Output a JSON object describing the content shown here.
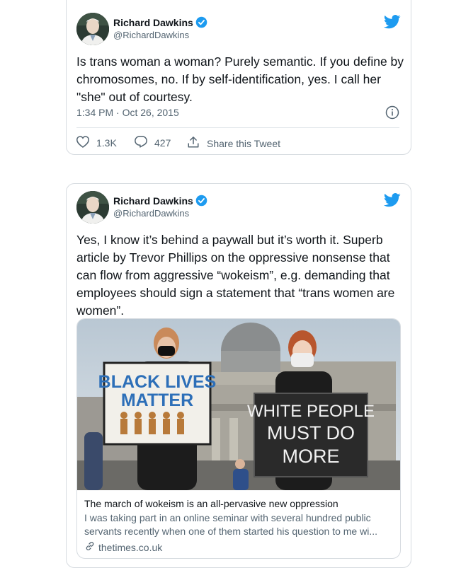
{
  "tweets": [
    {
      "author": "Richard Dawkins",
      "handle": "@RichardDawkins",
      "text": "Is trans woman a woman? Purely semantic. If you define by chromosomes, no. If by self-identification, yes. I call her \"she\" out of courtesy.",
      "timestamp": "1:34 PM · Oct 26, 2015",
      "likes": "1.3K",
      "replies": "427",
      "share_label": "Share this Tweet"
    },
    {
      "author": "Richard Dawkins",
      "handle": "@RichardDawkins",
      "text": "Yes, I know it’s behind a paywall but it’s worth it. Superb article by Trevor Phillips on the oppressive nonsense that can flow from aggressive “wokeism”, e.g. demanding that employees should sign a statement that “trans women are women”.",
      "link_card": {
        "title": "The march of wokeism is an all-pervasive new oppression",
        "description": "I was taking part in an online seminar with several hundred public servants recently when one of them started his question to me wi...",
        "domain": "thetimes.co.uk",
        "image": {
          "sign_left_line1": "BLACK LIVES",
          "sign_left_line2": "MATTER",
          "sign_right_line1": "WHITE PEOPLE",
          "sign_right_line2": "MUST DO",
          "sign_right_line3": "MORE"
        }
      }
    }
  ],
  "icons": [
    "twitter-bird-icon",
    "verified-badge-icon",
    "heart-icon",
    "reply-icon",
    "share-icon",
    "info-icon",
    "link-icon"
  ],
  "colors": {
    "twitter_blue": "#1d9bf0",
    "text_primary": "#0f1419",
    "text_secondary": "#536471",
    "border": "#d6dbe0"
  }
}
